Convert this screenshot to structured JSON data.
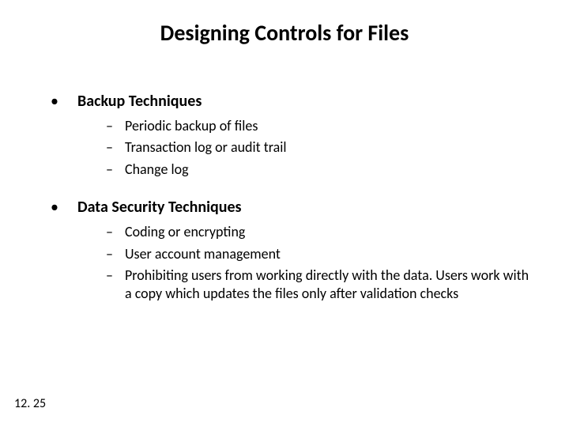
{
  "title": "Designing Controls for Files",
  "bullets": [
    {
      "label": "Backup Techniques",
      "children": [
        "Periodic backup of files",
        "Transaction log or audit trail",
        "Change log"
      ]
    },
    {
      "label": "Data Security Techniques",
      "children": [
        "Coding or encrypting",
        "User account management",
        "Prohibiting users from working directly with the data.  Users work with a copy which updates the files only after validation checks"
      ]
    }
  ],
  "glyphs": {
    "dot": "•",
    "dash": "–"
  },
  "page_number": "12. 25"
}
